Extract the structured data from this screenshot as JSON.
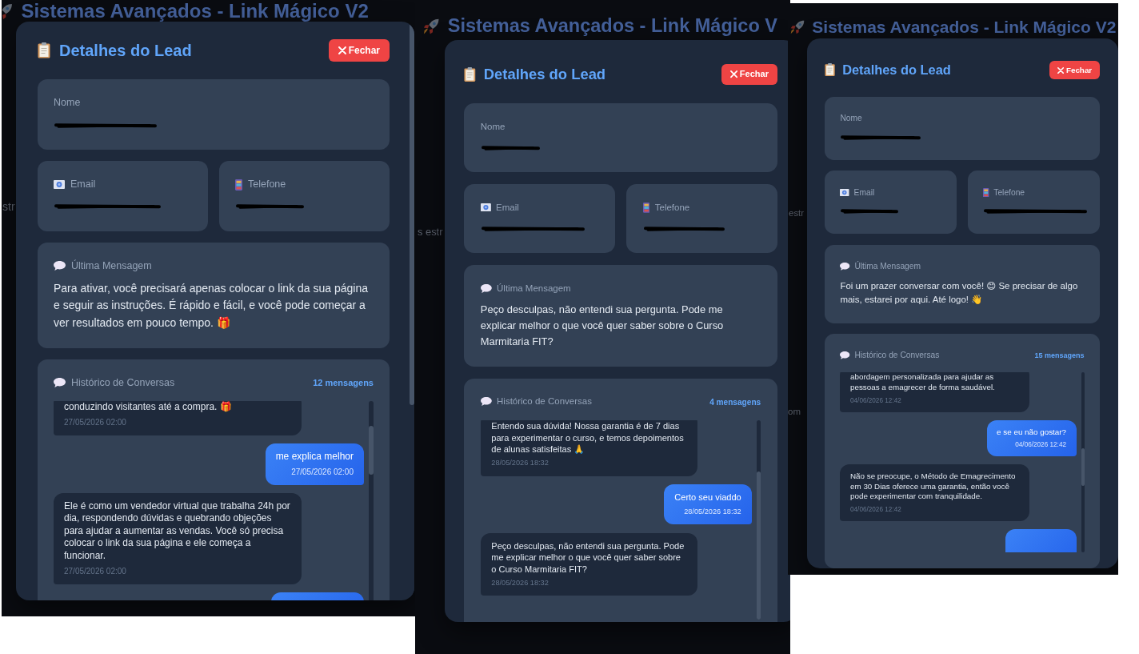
{
  "screenshots": [
    {
      "backdrop": {
        "heading": "Sistemas Avançados - Link Mágico V2",
        "fragments": [
          "str"
        ]
      },
      "modal": {
        "title": "Detalhes do Lead",
        "close_button": "Fechar",
        "fields": [
          {
            "kind": "name",
            "label": "Nome",
            "redacted": true
          },
          {
            "kind": "email",
            "label": "Email",
            "redacted": true
          },
          {
            "kind": "phone",
            "label": "Telefone",
            "redacted": true
          }
        ],
        "last_message": {
          "label": "Última Mensagem",
          "text": "Para ativar, você precisará apenas colocar o link da sua página e seguir as instruções. É rápido e fácil, e você pode começar a ver resultados em pouco tempo. 🎁"
        },
        "history": {
          "label": "Histórico de Conversas",
          "count": "12 mensagens",
          "messages": [
            {
              "kind": "bot",
              "text": "conduzindo visitantes até a compra. 🎁",
              "time": "27/05/2026 02:00"
            },
            {
              "kind": "user",
              "text": "me explica melhor",
              "time": "27/05/2026 02:00"
            },
            {
              "kind": "bot",
              "text": "Ele é como um vendedor virtual que trabalha 24h por dia, respondendo dúvidas e quebrando objeções para ajudar a aumentar as vendas. Você só precisa colocar o link da sua página e ele começa a funcionar.",
              "time": "27/05/2026 02:00"
            },
            {
              "kind": "user"
            }
          ]
        }
      }
    },
    {
      "backdrop": {
        "heading": "Sistemas Avançados - Link Mágico V",
        "fragments": [
          "s estr"
        ]
      },
      "modal": {
        "title": "Detalhes do Lead",
        "close_button": "Fechar",
        "fields": [
          {
            "kind": "name",
            "label": "Nome",
            "redacted": true
          },
          {
            "kind": "email",
            "label": "Email",
            "redacted": true
          },
          {
            "kind": "phone",
            "label": "Telefone",
            "redacted": true
          }
        ],
        "last_message": {
          "label": "Última Mensagem",
          "text": "Peço desculpas, não entendi sua pergunta. Pode me explicar melhor o que você quer saber sobre o Curso Marmitaria FIT?"
        },
        "history": {
          "label": "Histórico de Conversas",
          "count": "4 mensagens",
          "messages": [
            {
              "kind": "bot",
              "text": "Entendo sua dúvida! Nossa garantia é de 7 dias para experimentar o curso, e temos depoimentos de alunas satisfeitas 🙏",
              "time": "28/05/2026 18:32"
            },
            {
              "kind": "user",
              "text": "Certo seu viaddo",
              "time": "28/05/2026 18:32"
            },
            {
              "kind": "bot",
              "text": "Peço desculpas, não entendi sua pergunta. Pode me explicar melhor o que você quer saber sobre o Curso Marmitaria FIT?",
              "time": "28/05/2026 18:32"
            }
          ]
        }
      }
    },
    {
      "backdrop": {
        "heading": "Sistemas Avançados - Link Mágico V2",
        "fragments": [
          "estr",
          "om"
        ]
      },
      "modal": {
        "title": "Detalhes do Lead",
        "close_button": "Fechar",
        "fields": [
          {
            "kind": "name",
            "label": "Nome",
            "redacted": true
          },
          {
            "kind": "email",
            "label": "Email",
            "redacted": true
          },
          {
            "kind": "phone",
            "label": "Telefone",
            "redacted": true
          }
        ],
        "last_message": {
          "label": "Última Mensagem",
          "text": "Foi um prazer conversar com você! 😊 Se precisar de algo mais, estarei por aqui. Até logo! 👋"
        },
        "history": {
          "label": "Histórico de Conversas",
          "count": "15 mensagens",
          "messages": [
            {
              "kind": "bot",
              "text": "abordagem personalizada para ajudar as pessoas a emagrecer de forma saudável.",
              "time": "04/06/2026 12:42"
            },
            {
              "kind": "user",
              "text": "e se eu não gostar?",
              "time": "04/06/2026 12:42"
            },
            {
              "kind": "bot",
              "text": "Não se preocupe, o Método de Emagrecimento em 30 Dias oferece uma garantia, então você pode experimentar com tranquilidade.",
              "time": "04/06/2026 12:42"
            },
            {
              "kind": "user"
            }
          ]
        }
      }
    }
  ]
}
